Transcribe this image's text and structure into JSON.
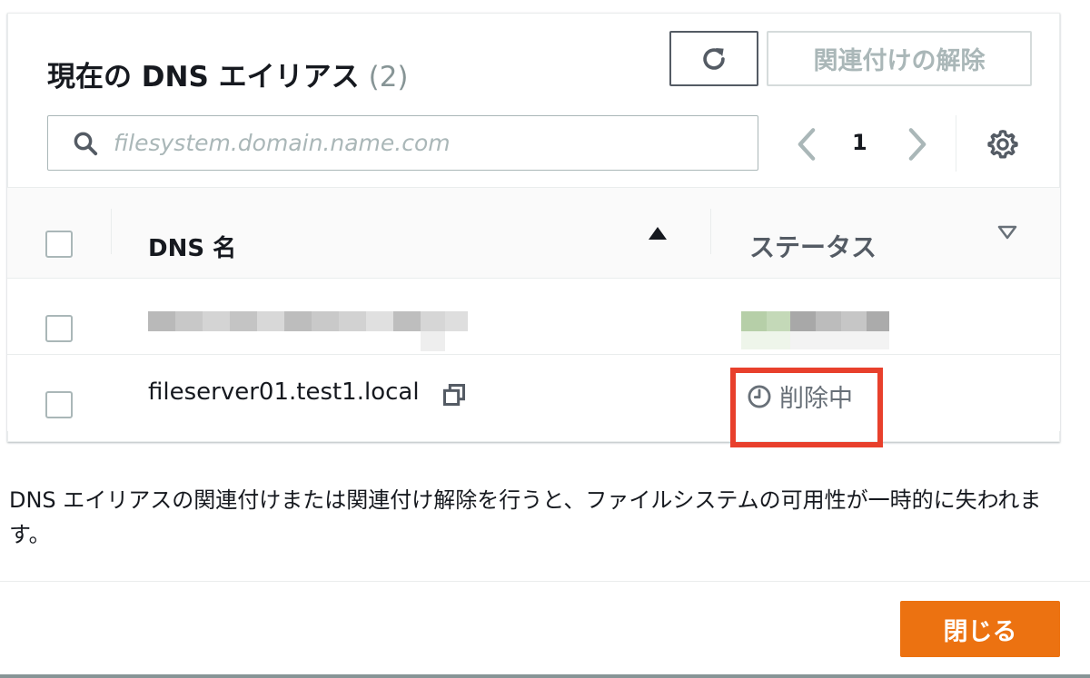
{
  "panel": {
    "title": "現在の DNS エイリアス",
    "count": "(2)",
    "refresh_icon": "refresh-icon",
    "disassociate_label": "関連付けの解除",
    "search": {
      "placeholder": "filesystem.domain.name.com",
      "value": ""
    },
    "pagination": {
      "current_page": "1"
    },
    "table": {
      "columns": [
        "DNS 名",
        "ステータス"
      ],
      "rows": [
        {
          "dns_name": "",
          "status": "",
          "redacted": true
        },
        {
          "dns_name": "fileserver01.test1.local",
          "status": "削除中",
          "status_icon": "clock-icon"
        }
      ]
    }
  },
  "note": "DNS エイリアスの関連付けまたは関連付け解除を行うと、ファイルシステムの可用性が一時的に失われます。",
  "footer": {
    "close_label": "閉じる"
  },
  "colors": {
    "primary": "#ec7211",
    "highlight": "#e8402c",
    "muted": "#aab7b8"
  }
}
